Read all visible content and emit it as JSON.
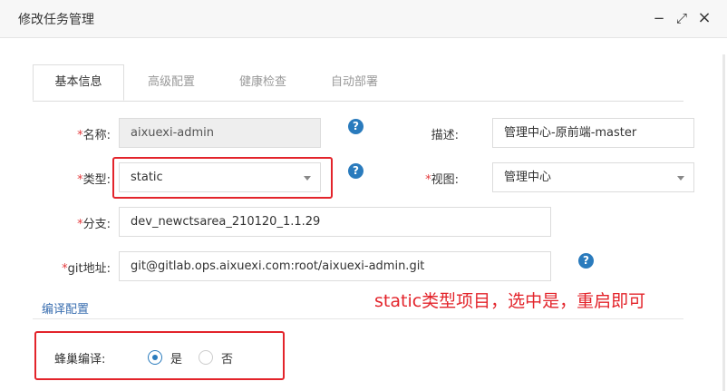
{
  "dialog": {
    "title": "修改任务管理",
    "minimize_symbol": "−",
    "maximize_symbol": "⤢",
    "close_symbol": "×"
  },
  "tabs": [
    {
      "label": "基本信息",
      "active": true
    },
    {
      "label": "高级配置",
      "active": false
    },
    {
      "label": "健康检查",
      "active": false
    },
    {
      "label": "自动部署",
      "active": false
    }
  ],
  "form": {
    "required_mark": "*",
    "help_symbol": "?",
    "name_label": "名称:",
    "name_value": "aixuexi-admin",
    "desc_label": "描述:",
    "desc_value": "管理中心-原前端-master",
    "type_label": "类型:",
    "type_value": "static",
    "view_label": "视图:",
    "view_value": "管理中心",
    "branch_label": "分支:",
    "branch_value": "dev_newctsarea_210120_1.1.29",
    "git_label": "git地址:",
    "git_value": "git@gitlab.ops.aixuexi.com:root/aixuexi-admin.git"
  },
  "compile_section": {
    "title": "编译配置",
    "hive_label": "蜂巢编译:",
    "option_yes": "是",
    "option_no": "否",
    "selected": "是"
  },
  "annotation": {
    "text": "static类型项目，选中是，重启即可",
    "color": "#e3242b"
  }
}
